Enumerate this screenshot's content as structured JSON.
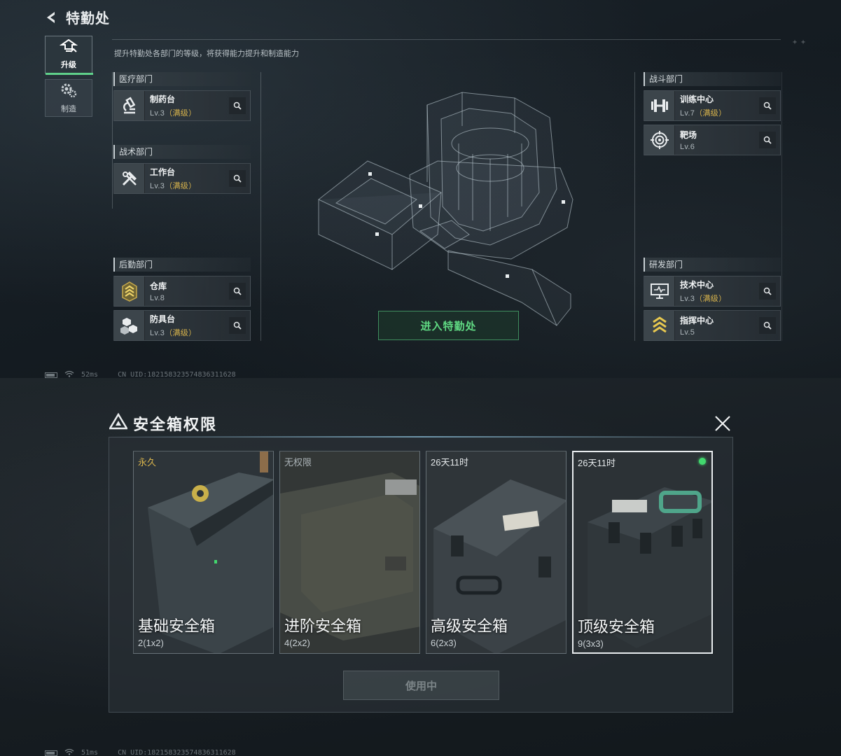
{
  "top": {
    "title": "特勤处",
    "subtitle": "提升特勤处各部门的等级，将获得能力提升和制造能力",
    "side_tabs": [
      {
        "label": "升级",
        "icon": "upgrade-icon",
        "active": true
      },
      {
        "label": "制造",
        "icon": "gear-icon",
        "active": false
      }
    ],
    "departments": {
      "medical": {
        "header": "医疗部门",
        "items": [
          {
            "name": "制药台",
            "level": "Lv.3",
            "maxed": "（满级）",
            "icon": "microscope-icon"
          }
        ]
      },
      "tactical": {
        "header": "战术部门",
        "items": [
          {
            "name": "工作台",
            "level": "Lv.3",
            "maxed": "（满级）",
            "icon": "tools-icon"
          }
        ]
      },
      "logistics": {
        "header": "后勤部门",
        "items": [
          {
            "name": "仓库",
            "level": "Lv.8",
            "maxed": "",
            "icon": "rank-chevrons-icon"
          },
          {
            "name": "防具台",
            "level": "Lv.3",
            "maxed": "（满级）",
            "icon": "blocks-icon"
          }
        ]
      },
      "combat": {
        "header": "战斗部门",
        "items": [
          {
            "name": "训练中心",
            "level": "Lv.7",
            "maxed": "（满级）",
            "icon": "dumbbell-icon"
          },
          {
            "name": "靶场",
            "level": "Lv.6",
            "maxed": "",
            "icon": "target-icon"
          }
        ]
      },
      "research": {
        "header": "研发部门",
        "items": [
          {
            "name": "技术中心",
            "level": "Lv.3",
            "maxed": "（满级）",
            "icon": "monitor-icon"
          },
          {
            "name": "指挥中心",
            "level": "Lv.5",
            "maxed": "",
            "icon": "rank-chevrons-icon"
          }
        ]
      }
    },
    "enter_button": "进入特勤处",
    "status": {
      "ping": "52ms",
      "uid": "CN UID:1821583235748363116​28"
    }
  },
  "bottom": {
    "title": "安全箱权限",
    "cases": [
      {
        "tag": "永久",
        "tag_color": "#d7b34c",
        "name": "基础安全箱",
        "size": "2(1x2)",
        "selected": false
      },
      {
        "tag": "无权限",
        "tag_color": "#a9b1b5",
        "name": "进阶安全箱",
        "size": "4(2x2)",
        "selected": false
      },
      {
        "tag": "26天11时",
        "tag_color": "#e3e7e9",
        "name": "高级安全箱",
        "size": "6(2x3)",
        "selected": false
      },
      {
        "tag": "26天11时",
        "tag_color": "#e3e7e9",
        "name": "顶级安全箱",
        "size": "9(3x3)",
        "selected": true
      }
    ],
    "use_button": "使用中",
    "status": {
      "ping": "51ms",
      "uid": "CN UID:182158323574836311628"
    }
  },
  "colors": {
    "accent_green": "#5fd882",
    "gold": "#d7b34c",
    "equipped": "#42d86e"
  }
}
